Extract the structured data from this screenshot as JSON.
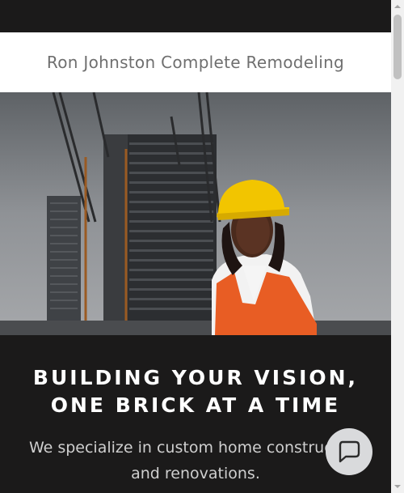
{
  "header": {
    "site_title": "Ron Johnston Complete Remodeling"
  },
  "hero": {
    "image_alt": "Construction worker in hard hat and safety vest in front of a high-rise under construction"
  },
  "content": {
    "headline_line1": "BUILDING YOUR VISION,",
    "headline_line2": "ONE BRICK AT A TIME",
    "subtext": "We specialize in custom home construction and renovations."
  },
  "chat": {
    "icon": "chat-bubble-icon"
  },
  "colors": {
    "background": "#1b1a1a",
    "header_bg": "#ffffff",
    "title_text": "#6f6f6f",
    "chat_button": "#d9dadc"
  }
}
